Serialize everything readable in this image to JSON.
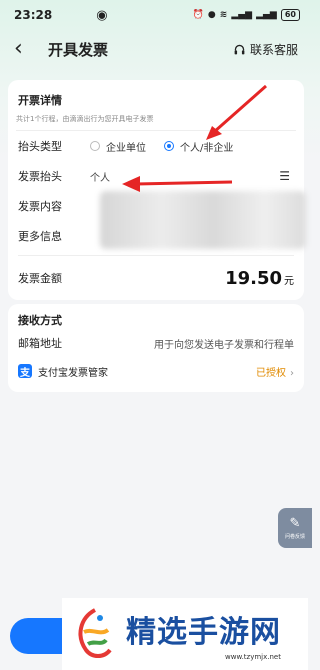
{
  "status": {
    "time": "23:28",
    "battery": "60"
  },
  "nav": {
    "title": "开具发票",
    "service_label": "联系客服"
  },
  "details": {
    "section_title": "开票详情",
    "hint": "共计1个行程，由滴滴出行为您开具电子发票",
    "header_type_label": "抬头类型",
    "option_company": "企业单位",
    "option_personal": "个人/非企业",
    "selected_option": "option_personal",
    "invoice_title_label": "发票抬头",
    "invoice_title_value": "个人",
    "content_label": "发票内容",
    "more_info_label": "更多信息",
    "amount_label": "发票金额",
    "amount_value": "19.50",
    "amount_unit": "元"
  },
  "receive": {
    "section_title": "接收方式",
    "email_label": "邮箱地址",
    "email_placeholder": "用于向您发送电子发票和行程单",
    "alipay_icon": "支",
    "alipay_label": "支付宝发票管家",
    "alipay_status": "已授权"
  },
  "float_button": {
    "label": "问卷反馈"
  },
  "watermark": {
    "title": "精选手游网",
    "url": "www.tzymjx.net"
  },
  "colors": {
    "accent": "#1677ff",
    "arrow": "#e52525",
    "authorized": "#e08a00"
  }
}
